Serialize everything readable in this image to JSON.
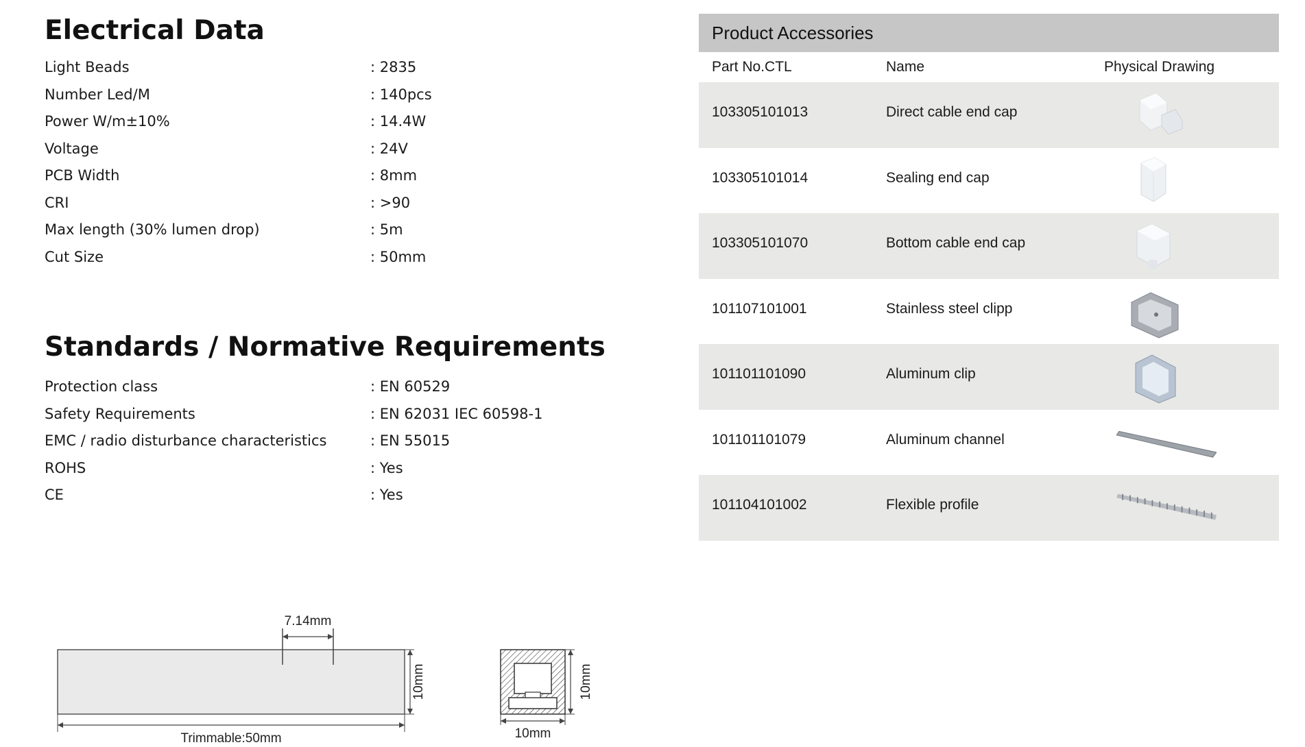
{
  "electrical": {
    "title": "Electrical Data",
    "rows": [
      {
        "label": "Light Beads",
        "value": ": 2835"
      },
      {
        "label": "Number Led/M",
        "value": ": 140pcs"
      },
      {
        "label": "Power W/m±10%",
        "value": ": 14.4W"
      },
      {
        "label": "Voltage",
        "value": ": 24V"
      },
      {
        "label": "PCB Width",
        "value": ": 8mm"
      },
      {
        "label": "CRI",
        "value": ": >90"
      },
      {
        "label": "Max length (30% lumen drop)",
        "value": ": 5m"
      },
      {
        "label": "Cut Size",
        "value": ": 50mm"
      }
    ]
  },
  "standards": {
    "title": "Standards / Normative Requirements",
    "rows": [
      {
        "label": "Protection class",
        "value": ": EN 60529"
      },
      {
        "label": "Safety Requirements",
        "value": ": EN 62031 IEC 60598-1"
      },
      {
        "label": "EMC / radio disturbance characteristics",
        "value": ": EN 55015"
      },
      {
        "label": "ROHS",
        "value": ": Yes"
      },
      {
        "label": "CE",
        "value": ": Yes"
      }
    ]
  },
  "accessories": {
    "title": "Product Accessories",
    "columns": {
      "part": "Part No.CTL",
      "name": "Name",
      "drawing": "Physical Drawing"
    },
    "rows": [
      {
        "part": "103305101013",
        "name": "Direct cable end cap",
        "icon": "direct-cable-end-cap"
      },
      {
        "part": "103305101014",
        "name": "Sealing end cap",
        "icon": "sealing-end-cap"
      },
      {
        "part": "103305101070",
        "name": "Bottom cable end cap",
        "icon": "bottom-cable-end-cap"
      },
      {
        "part": "101107101001",
        "name": "Stainless steel clipp",
        "icon": "stainless-steel-clip"
      },
      {
        "part": "101101101090",
        "name": "Aluminum clip",
        "icon": "aluminum-clip"
      },
      {
        "part": "101101101079",
        "name": "Aluminum channel",
        "icon": "aluminum-channel"
      },
      {
        "part": "101104101002",
        "name": "Flexible profile",
        "icon": "flexible-profile"
      }
    ]
  },
  "diagram": {
    "top_dim": "7.14mm",
    "side_height": "10mm",
    "bottom_length": "Trimmable:50mm",
    "cross_height": "10mm",
    "cross_width": "10mm"
  }
}
